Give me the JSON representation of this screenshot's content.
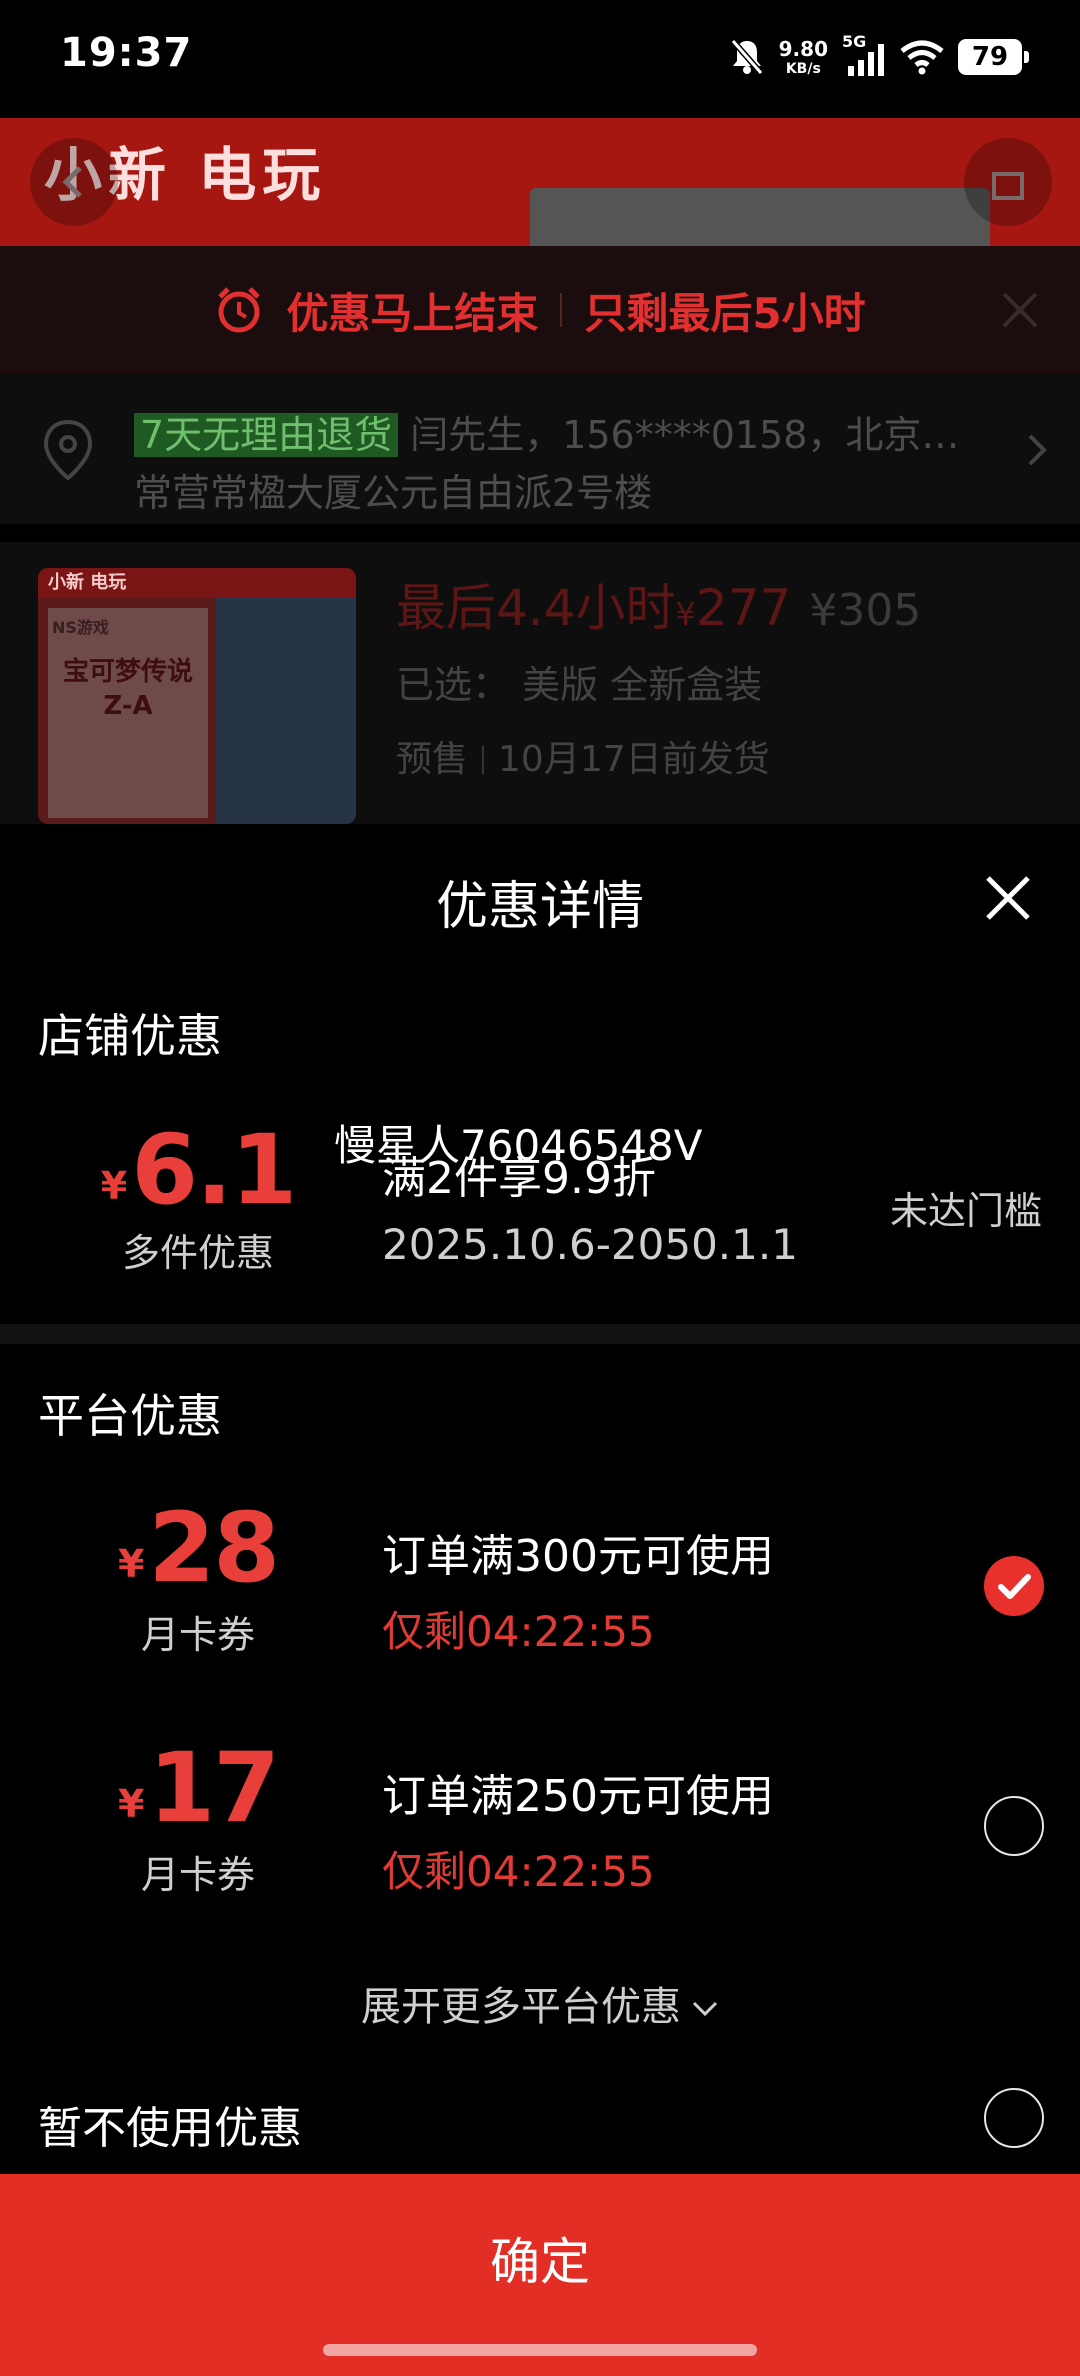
{
  "status_bar": {
    "time": "19:37",
    "net_speed_value": "9.80",
    "net_speed_unit": "KB/s",
    "network": "5G",
    "battery": "79"
  },
  "background_page": {
    "brand": "小新 电玩",
    "banner": {
      "left_text": "优惠马上结束",
      "right_text": "只剩最后5小时"
    },
    "address": {
      "tag": "7天无理由退货",
      "line1": "闫先生，156****0158，北京…",
      "line2": "常营常楹大厦公元自由派2号楼"
    },
    "product": {
      "thumb_brand": "小新 电玩",
      "thumb_platform": "NS游戏",
      "thumb_title": "宝可梦传说 Z-A",
      "countdown_price": "最后4.4小时",
      "price_symbol": "¥",
      "price": "277",
      "original_price": "¥305",
      "spec_label": "已选：",
      "spec_value": "美版 全新盒装",
      "ship_label": "预售",
      "ship_value": "10月17日前发货"
    }
  },
  "sheet": {
    "title": "优惠详情",
    "store_section": {
      "title": "店铺优惠",
      "coupon": {
        "currency": "¥",
        "amount": "6.1",
        "type": "多件优惠",
        "condition": "满2件享9.9折",
        "validity": "2025.10.6-2050.1.1",
        "status": "未达门槛"
      }
    },
    "overlay_label": "慢星人76046548V",
    "platform_section": {
      "title": "平台优惠",
      "coupons": [
        {
          "currency": "¥",
          "amount": "28",
          "type": "月卡券",
          "condition": "订单满300元可使用",
          "timer": "仅剩04:22:55",
          "selected": true
        },
        {
          "currency": "¥",
          "amount": "17",
          "type": "月卡券",
          "condition": "订单满250元可使用",
          "timer": "仅剩04:22:55",
          "selected": false
        }
      ],
      "expand_label": "展开更多平台优惠"
    },
    "no_coupon_label": "暂不使用优惠",
    "confirm_label": "确定"
  },
  "colors": {
    "accent_red": "#e93f3a",
    "confirm_red": "#e32e26",
    "background": "#000000"
  }
}
